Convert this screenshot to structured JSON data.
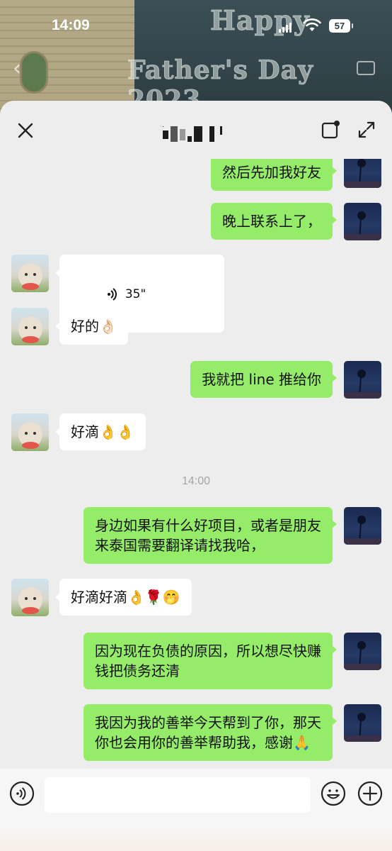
{
  "status_bar": {
    "time": "14:09",
    "battery": "57"
  },
  "background": {
    "banner_line1": "Happy",
    "banner_line2": "Father's Day 2023"
  },
  "chat": {
    "title": ""
  },
  "messages": [
    {
      "side": "me",
      "text": "然后先加我好友"
    },
    {
      "side": "me",
      "text": "晚上联系上了，"
    },
    {
      "side": "other",
      "type": "voice",
      "text": "35\""
    },
    {
      "side": "other",
      "text": "好的👌🏻"
    },
    {
      "side": "me",
      "text": "我就把 line 推给你"
    },
    {
      "side": "other",
      "text": "好滴👌👌"
    },
    {
      "type": "time",
      "text": "14:00"
    },
    {
      "side": "me",
      "text": "身边如果有什么好项目，或者是朋友\n来泰国需要翻译请找我哈，"
    },
    {
      "side": "other",
      "text": "好滴好滴👌🌹🤭"
    },
    {
      "side": "me",
      "text": "因为现在负债的原因，所以想尽快赚\n钱把债务还清"
    },
    {
      "side": "me",
      "text": "我因为我的善举今天帮到了你，那天\n你也会用你的善举帮助我，感谢🙏"
    }
  ],
  "input": {
    "placeholder": ""
  },
  "icons": {
    "close": "close-icon",
    "mini_program": "window-icon",
    "expand": "expand-icon",
    "voice": "voice-icon",
    "emoji": "emoji-icon",
    "plus": "plus-icon"
  },
  "colors": {
    "my_bubble": "#95ec69",
    "other_bubble": "#ffffff",
    "sheet": "#ededed"
  }
}
